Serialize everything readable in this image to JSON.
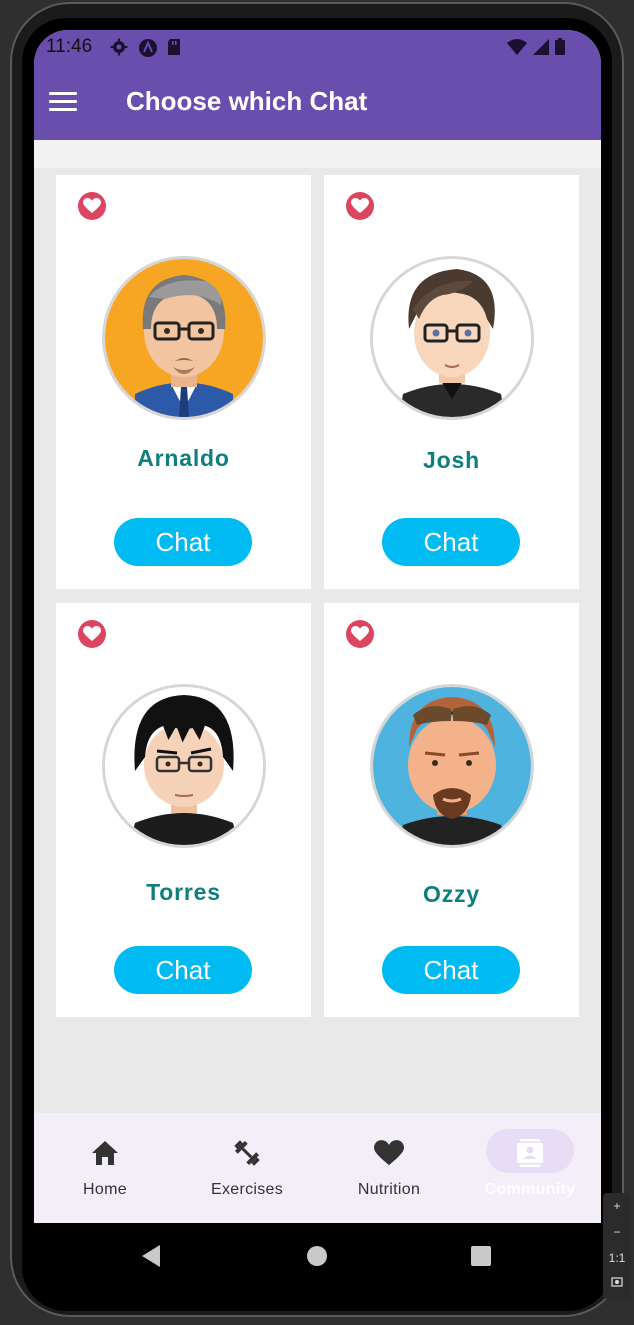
{
  "status_bar": {
    "time": "11:46",
    "left_icons": [
      "settings-icon",
      "app-icon",
      "sd-card-icon"
    ],
    "right_icons": [
      "wifi-icon",
      "signal-icon",
      "battery-icon"
    ]
  },
  "app_bar": {
    "title": "Choose which Chat",
    "menu_icon": "hamburger-menu-icon",
    "background": "#6a4ead"
  },
  "cards": [
    {
      "name": "Arnaldo",
      "button": "Chat",
      "favorite": true
    },
    {
      "name": "Josh",
      "button": "Chat",
      "favorite": true
    },
    {
      "name": "Torres",
      "button": "Chat",
      "favorite": true
    },
    {
      "name": "Ozzy",
      "button": "Chat",
      "favorite": true
    }
  ],
  "bottom_nav": [
    {
      "label": "Home",
      "icon": "home-icon",
      "selected": false
    },
    {
      "label": "Exercises",
      "icon": "dumbbell-icon",
      "selected": false
    },
    {
      "label": "Nutrition",
      "icon": "heart-icon",
      "selected": false
    },
    {
      "label": "Community",
      "icon": "contacts-icon",
      "selected": true
    }
  ],
  "emulator_toolbar": {
    "zoom_in": "+",
    "zoom_out": "−",
    "ratio": "1:1"
  },
  "colors": {
    "accent": "#6a4ead",
    "chat_button": "#00baf2",
    "name_text": "#0f7e7e",
    "heart": "#dc4560",
    "nav_background": "#f3eef8"
  }
}
